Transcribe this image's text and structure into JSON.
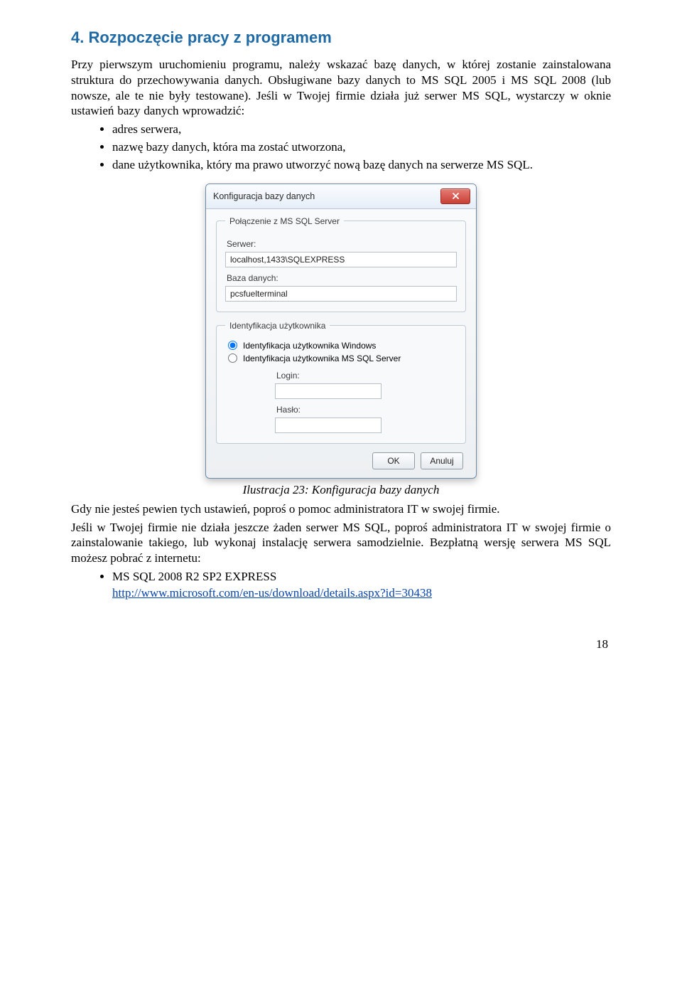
{
  "heading": "4. Rozpoczęcie pracy z programem",
  "para1": "Przy pierwszym uruchomieniu programu, należy wskazać bazę danych, w której zostanie zainstalowana struktura do przechowywania danych. Obsługiwane bazy danych to MS SQL 2005 i MS SQL 2008 (lub nowsze, ale te nie były testowane). Jeśli w Twojej firmie działa już serwer MS SQL, wystarczy w oknie ustawień bazy danych wprowadzić:",
  "bullets1": [
    "adres serwera,",
    "nazwę bazy danych, która ma zostać utworzona,",
    "dane użytkownika, który ma prawo utworzyć nową bazę danych na serwerze MS SQL."
  ],
  "dialog": {
    "title": "Konfiguracja bazy danych",
    "group_conn": "Połączenie z MS SQL Server",
    "label_server": "Serwer:",
    "value_server": "localhost,1433\\SQLEXPRESS",
    "label_db": "Baza danych:",
    "value_db": "pcsfuelterminal",
    "group_auth": "Identyfikacja użytkownika",
    "radio_win": "Identyfikacja użytkownika Windows",
    "radio_sql": "Identyfikacja użytkownika MS SQL Server",
    "label_login": "Login:",
    "label_pass": "Hasło:",
    "btn_ok": "OK",
    "btn_cancel": "Anuluj"
  },
  "caption": "Ilustracja 23: Konfiguracja bazy danych",
  "para2": "Gdy nie jesteś pewien tych ustawień, poproś o pomoc administratora IT w swojej firmie.",
  "para3": "Jeśli w Twojej firmie nie działa jeszcze żaden serwer MS SQL, poproś administratora IT w swojej firmie o zainstalowanie takiego, lub wykonaj instalację serwera samodzielnie. Bezpłatną wersję serwera MS SQL możesz pobrać z internetu:",
  "bullets2_label": "MS SQL 2008 R2 SP2 EXPRESS",
  "bullets2_link": "http://www.microsoft.com/en-us/download/details.aspx?id=30438",
  "page_number": "18"
}
